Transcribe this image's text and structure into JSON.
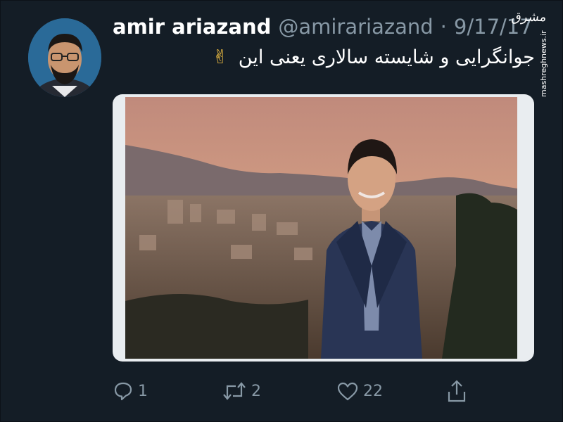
{
  "tweet": {
    "display_name": "amir ariazand",
    "handle": "@amirariazand",
    "separator": "·",
    "date": "9/17/17",
    "text": "جوانگرایی و شایسته سالاری یعنی این",
    "emoji": "✌"
  },
  "watermark": {
    "logo": "مشرق",
    "url": "mashreghnews.ir"
  },
  "actions": {
    "reply_count": "1",
    "retweet_count": "2",
    "like_count": "22"
  },
  "icons": {
    "reply": "reply-icon",
    "retweet": "retweet-icon",
    "like": "heart-icon",
    "share": "share-icon"
  },
  "colors": {
    "background": "#141d26",
    "muted": "#8899a6",
    "text": "#ffffff"
  }
}
